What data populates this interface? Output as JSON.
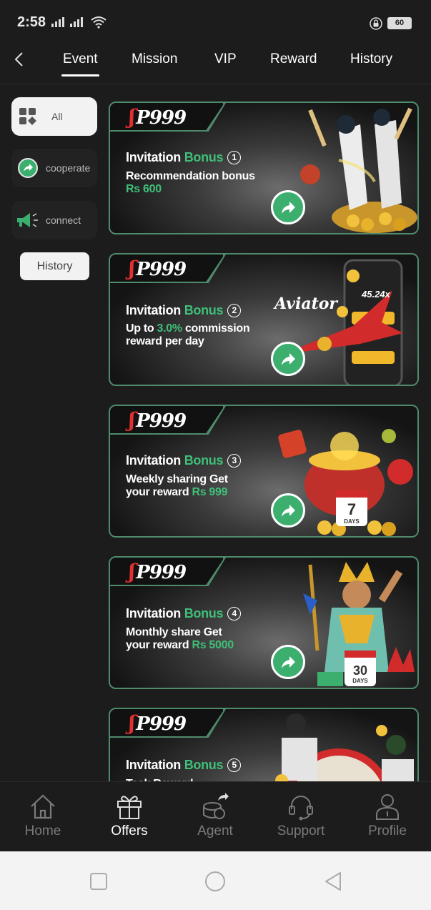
{
  "status_bar": {
    "time": "2:58",
    "battery": "60",
    "icons": [
      "signal-icon",
      "wifi-icon",
      "lock-icon",
      "battery-icon"
    ]
  },
  "tabs": [
    {
      "label": "Event",
      "active": true
    },
    {
      "label": "Mission",
      "active": false
    },
    {
      "label": "VIP",
      "active": false
    },
    {
      "label": "Reward",
      "active": false
    },
    {
      "label": "History",
      "active": false
    }
  ],
  "sidebar": {
    "items": [
      {
        "label": "All",
        "icon": "grid-icon",
        "active": true
      },
      {
        "label": "cooperate",
        "icon": "share-icon",
        "active": false
      },
      {
        "label": "connect",
        "icon": "megaphone-icon",
        "active": false
      }
    ],
    "history_label": "History"
  },
  "cards": [
    {
      "brand": "P999",
      "title_prefix": "Invitation ",
      "title_highlight": "Bonus",
      "number": "1",
      "line1": "Recommendation bonus",
      "line2_prefix": "",
      "line2_highlight": "Rs 600",
      "art": "cricket-players"
    },
    {
      "brand": "P999",
      "title_prefix": "Invitation ",
      "title_highlight": "Bonus",
      "number": "2",
      "line1_prefix": "Up to ",
      "line1_highlight": "3.0%",
      "line1_suffix": " commission",
      "line2": "reward per day",
      "art": "aviator-plane",
      "art_text": "Aviator",
      "art_multiplier": "45.24x"
    },
    {
      "brand": "P999",
      "title_prefix": "Invitation ",
      "title_highlight": "Bonus",
      "number": "3",
      "line1": "Weekly sharing Get",
      "line2_prefix": "your reward ",
      "line2_highlight": "Rs 999",
      "art": "treasure-pot",
      "art_badge": "7",
      "art_badge_sub": "DAYS"
    },
    {
      "brand": "P999",
      "title_prefix": "Invitation ",
      "title_highlight": "Bonus",
      "number": "4",
      "line1": "Monthly share Get",
      "line2_prefix": "your reward ",
      "line2_highlight": "Rs 5000",
      "art": "warrior-king",
      "art_badge": "30",
      "art_badge_sub": "DAYS"
    },
    {
      "brand": "P999",
      "title_prefix": "Invitation ",
      "title_highlight": "Bonus",
      "number": "5",
      "line1": "Task Reward",
      "art": "cricket-wheel"
    }
  ],
  "bottom_nav": [
    {
      "label": "Home",
      "icon": "home-icon",
      "active": false
    },
    {
      "label": "Offers",
      "icon": "gift-icon",
      "active": true
    },
    {
      "label": "Agent",
      "icon": "agent-icon",
      "active": false
    },
    {
      "label": "Support",
      "icon": "headset-icon",
      "active": false
    },
    {
      "label": "Profile",
      "icon": "profile-icon",
      "active": false
    }
  ],
  "colors": {
    "background": "#1c1c1c",
    "accent_green": "#3fbf78",
    "card_border": "#4f8a6d"
  }
}
